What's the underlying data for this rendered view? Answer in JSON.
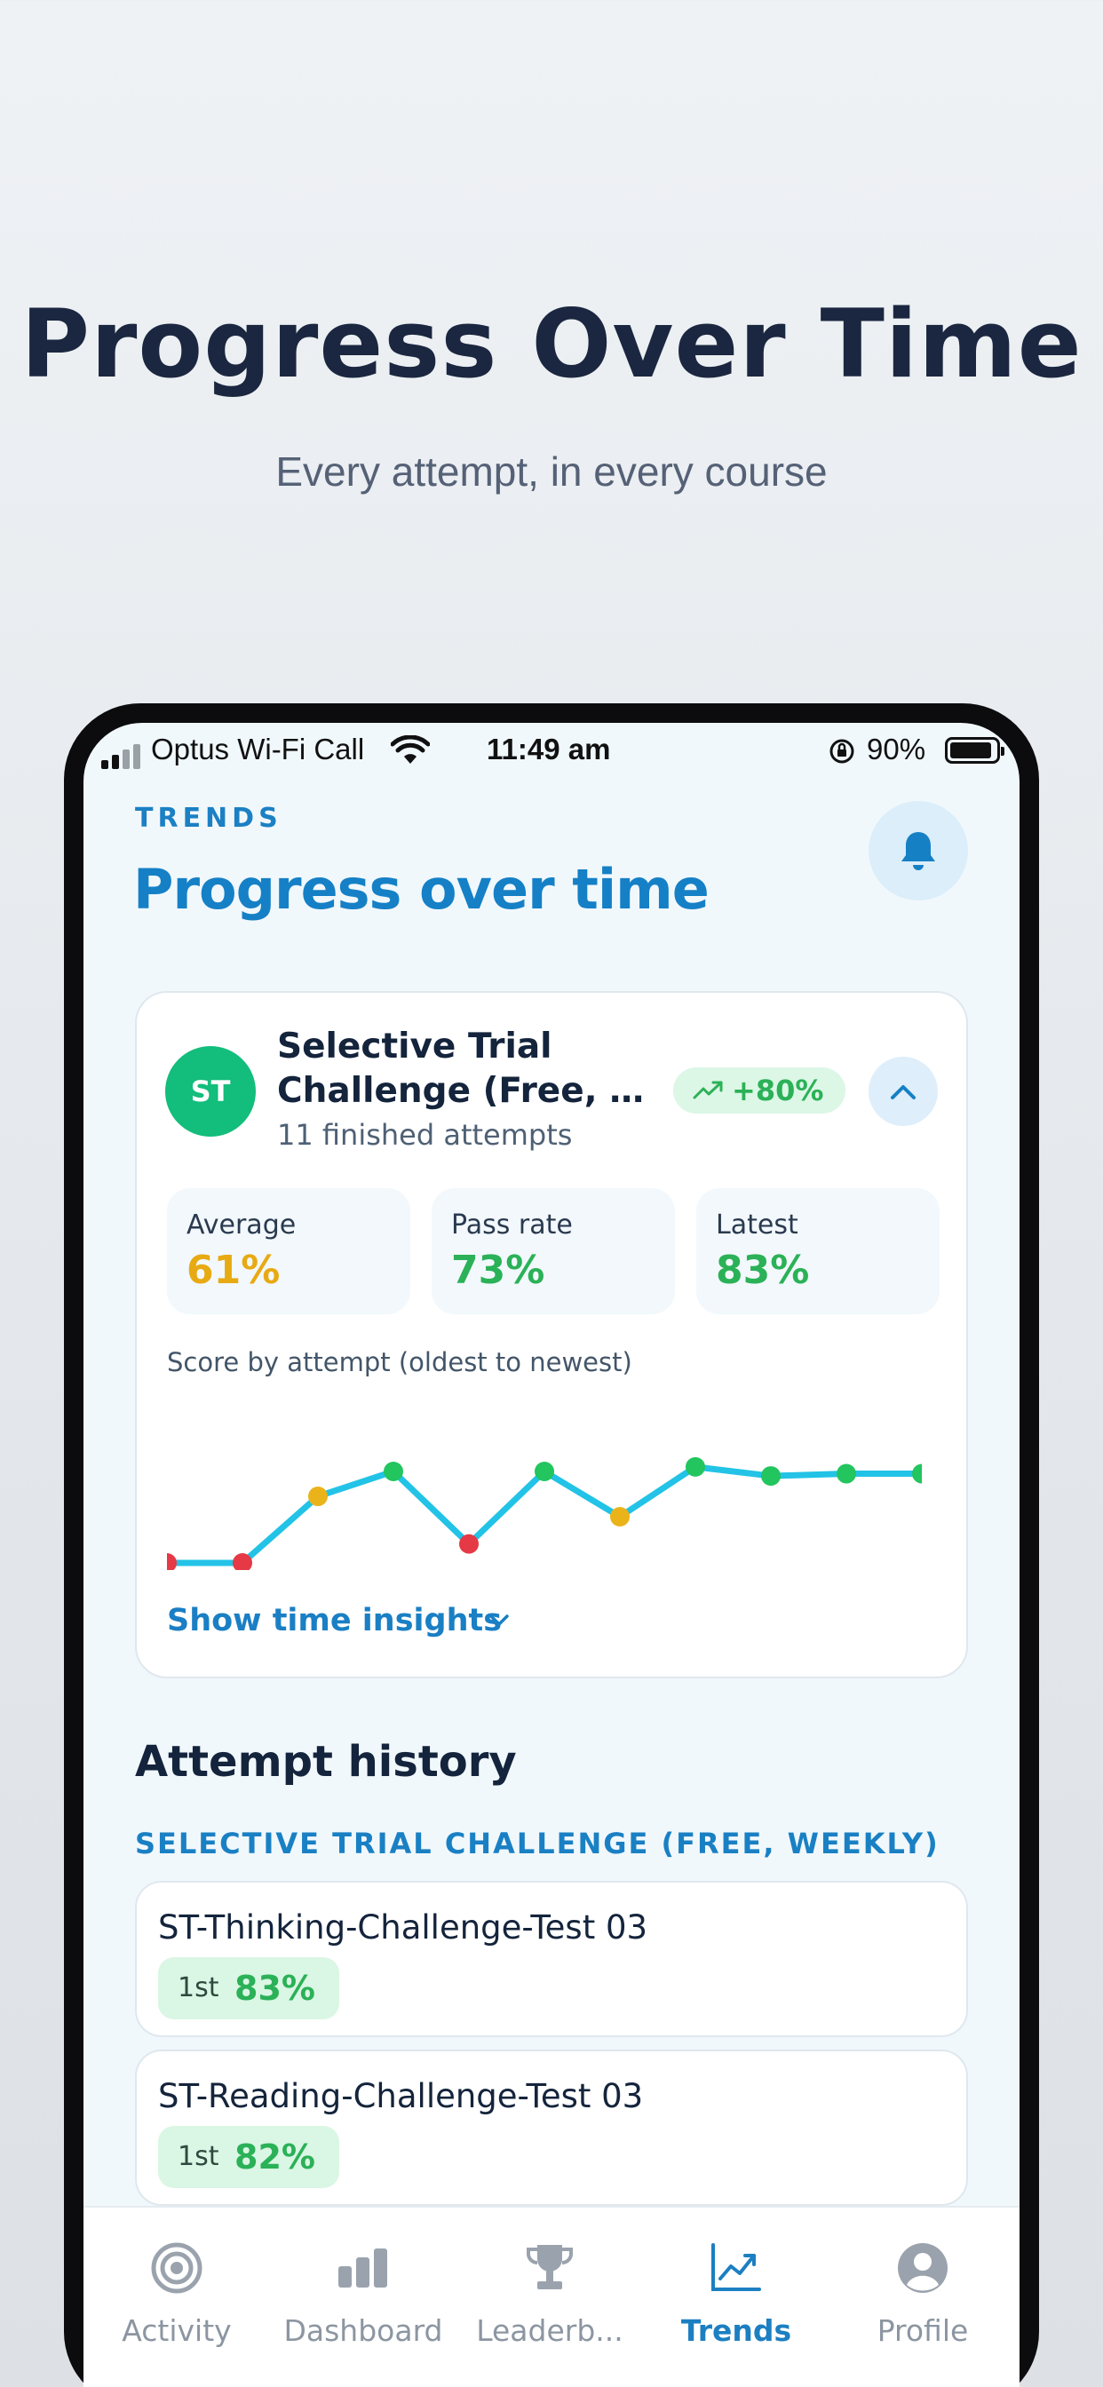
{
  "hero": {
    "title": "Progress Over Time",
    "subtitle": "Every attempt, in every course"
  },
  "status_bar": {
    "carrier": "Optus Wi-Fi Call",
    "time": "11:49 am",
    "battery": "90%"
  },
  "header": {
    "eyebrow": "TRENDS",
    "title": "Progress over time",
    "bell_icon": "bell-icon"
  },
  "course_card": {
    "avatar": "ST",
    "title_line1": "Selective Trial",
    "title_line2": "Challenge (Free, Weekly)",
    "subtitle": "11 finished attempts",
    "delta": "+80%",
    "stats": [
      {
        "label": "Average",
        "value": "61%",
        "color": "#e8aa12"
      },
      {
        "label": "Pass rate",
        "value": "73%",
        "color": "#2bb157"
      },
      {
        "label": "Latest",
        "value": "83%",
        "color": "#2bb157"
      }
    ],
    "chart_label": "Score by attempt (oldest to newest)",
    "insights_label": "Show time insights"
  },
  "chart_data": {
    "type": "line",
    "x": [
      1,
      2,
      3,
      4,
      5,
      6,
      7,
      8,
      9,
      10,
      11
    ],
    "series": [
      {
        "values": [
          3,
          4,
          51,
          62,
          30,
          62,
          42,
          64,
          60,
          61,
          61
        ]
      }
    ],
    "ylim": [
      0,
      100
    ],
    "point_colors": [
      "#e53945",
      "#e53945",
      "#eab31a",
      "#22c55e",
      "#e53945",
      "#22c55e",
      "#eab31a",
      "#22c55e",
      "#22c55e",
      "#22c55e",
      "#22c55e"
    ],
    "line_color": "#22c3e6"
  },
  "history": {
    "title": "Attempt history",
    "group_label": "SELECTIVE TRIAL CHALLENGE (FREE, WEEKLY)",
    "attempts": [
      {
        "name": "ST-Thinking-Challenge-Test 03",
        "rank": "1st",
        "score": "83%"
      },
      {
        "name": "ST-Reading-Challenge-Test 03",
        "rank": "1st",
        "score": "82%"
      }
    ]
  },
  "tabs": [
    {
      "label": "Activity",
      "icon": "target-icon",
      "active": false
    },
    {
      "label": "Dashboard",
      "icon": "bar-chart-icon",
      "active": false
    },
    {
      "label": "Leaderb...",
      "icon": "trophy-icon",
      "active": false
    },
    {
      "label": "Trends",
      "icon": "trend-icon",
      "active": true
    },
    {
      "label": "Profile",
      "icon": "user-icon",
      "active": false
    }
  ]
}
